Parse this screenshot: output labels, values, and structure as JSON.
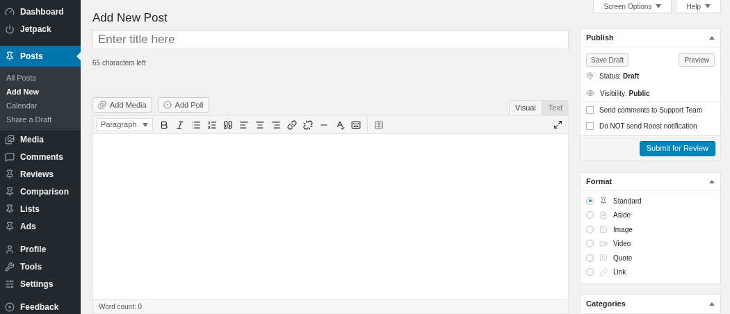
{
  "sidebar": {
    "groups": [
      [
        {
          "label": "Dashboard",
          "selected": false
        },
        {
          "label": "Jetpack",
          "selected": false
        }
      ],
      [
        {
          "label": "Posts",
          "selected": true,
          "children": [
            {
              "label": "All Posts",
              "selected": false
            },
            {
              "label": "Add New",
              "selected": true
            },
            {
              "label": "Calendar",
              "selected": false
            },
            {
              "label": "Share a Draft",
              "selected": false
            }
          ]
        },
        {
          "label": "Media",
          "selected": false
        },
        {
          "label": "Comments",
          "selected": false
        },
        {
          "label": "Reviews",
          "selected": false
        },
        {
          "label": "Comparison",
          "selected": false
        },
        {
          "label": "Lists",
          "selected": false
        },
        {
          "label": "Ads",
          "selected": false
        }
      ],
      [
        {
          "label": "Profile",
          "selected": false
        },
        {
          "label": "Tools",
          "selected": false
        },
        {
          "label": "Settings",
          "selected": false
        }
      ],
      [
        {
          "label": "Feedback",
          "selected": false
        }
      ]
    ]
  },
  "top_buttons": [
    "Screen Options",
    "Help"
  ],
  "page_title": "Add New Post",
  "title_field": {
    "placeholder": "Enter title here"
  },
  "chars_left": "65 characters left",
  "media_buttons": [
    "Add Media",
    "Add Poll"
  ],
  "editor_tabs": [
    {
      "label": "Visual",
      "selected": true
    },
    {
      "label": "Text",
      "selected": false
    }
  ],
  "format_select": "Paragraph",
  "word_count": "Word count: 0",
  "publish": {
    "title": "Publish",
    "save_draft": "Save Draft",
    "preview": "Preview",
    "status_label": "Status:",
    "status": "Draft",
    "visibility_label": "Visibility:",
    "visibility": "Public",
    "options": [
      {
        "label": "Send comments to Support Team",
        "checked": false
      },
      {
        "label": "Do NOT send Roost notification",
        "checked": false
      }
    ],
    "submit": "Submit for Review"
  },
  "format": {
    "title": "Format",
    "options": [
      {
        "label": "Standard",
        "selected": true
      },
      {
        "label": "Aside",
        "selected": false
      },
      {
        "label": "Image",
        "selected": false
      },
      {
        "label": "Video",
        "selected": false
      },
      {
        "label": "Quote",
        "selected": false
      },
      {
        "label": "Link",
        "selected": false
      }
    ]
  },
  "categories": {
    "title": "Categories"
  }
}
